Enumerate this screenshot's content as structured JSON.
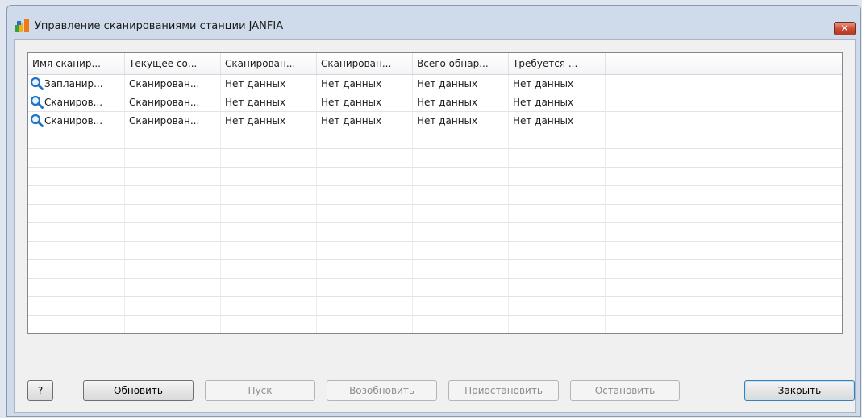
{
  "window": {
    "title": "Управление сканированиями станции JANFIA",
    "close_glyph": "✕"
  },
  "table": {
    "columns": [
      "Имя сканир...",
      "Текущее со...",
      "Сканирован...",
      "Сканирован...",
      "Всего обнар...",
      "Требуется ..."
    ],
    "rows": [
      {
        "icon": "magnifier-icon",
        "cells": [
          "Запланир...",
          "Сканирован...",
          "Нет данных",
          "Нет данных",
          "Нет данных",
          "Нет данных"
        ]
      },
      {
        "icon": "magnifier-icon",
        "cells": [
          "Сканиров...",
          "Сканирован...",
          "Нет данных",
          "Нет данных",
          "Нет данных",
          "Нет данных"
        ]
      },
      {
        "icon": "magnifier-icon",
        "cells": [
          "Сканиров...",
          "Сканирован...",
          "Нет данных",
          "Нет данных",
          "Нет данных",
          "Нет данных"
        ]
      }
    ]
  },
  "buttons": {
    "help": "?",
    "refresh": "Обновить",
    "start": "Пуск",
    "resume": "Возобновить",
    "pause": "Приостановить",
    "stop": "Остановить",
    "close": "Закрыть"
  },
  "colors": {
    "icon_blue": "#1e73c8",
    "app_icon_orange": "#f07a1a",
    "app_icon_green": "#3aa03a"
  }
}
